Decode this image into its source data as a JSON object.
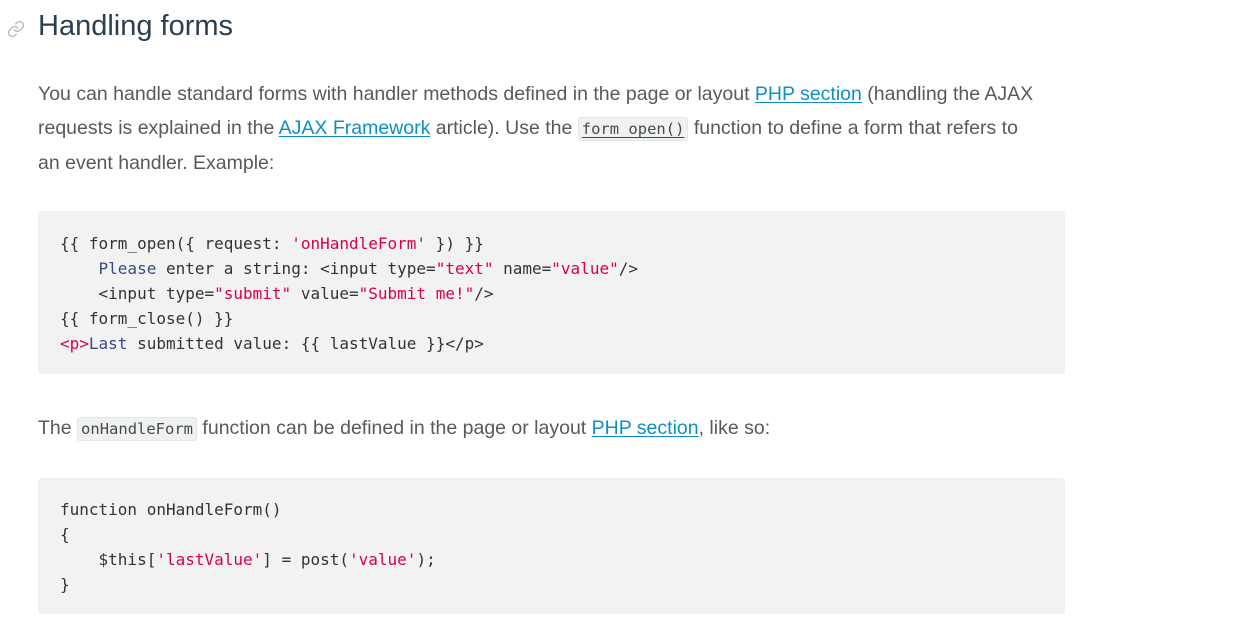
{
  "section": {
    "anchor_icon": "link-icon",
    "title": "Handling forms"
  },
  "intro": {
    "line1_text": "You can handle standard forms with handler methods defined in the page or layout ",
    "line1_link": "PHP section",
    "line1_after": " (handling the AJAX",
    "line2_before": "requests is explained in the ",
    "line2_link": "AJAX Framework",
    "line2_middle": " article). Use the ",
    "line2_code": "form_open()",
    "line2_after": " function to define a form that refers to",
    "line3_text": "an event handler. Example:"
  },
  "code_block_1": {
    "lines": [
      [
        {
          "t": "plain",
          "v": "{{ form_open({ request: "
        },
        {
          "t": "str",
          "v": "'onHandleForm'"
        },
        {
          "t": "plain",
          "v": " }) }}"
        }
      ],
      [
        {
          "t": "plain",
          "v": "    "
        },
        {
          "t": "kw",
          "v": "Please"
        },
        {
          "t": "plain",
          "v": " enter a string: <input type="
        },
        {
          "t": "str",
          "v": "\"text\""
        },
        {
          "t": "plain",
          "v": " name="
        },
        {
          "t": "str",
          "v": "\"value\""
        },
        {
          "t": "plain",
          "v": "/>"
        }
      ],
      [
        {
          "t": "plain",
          "v": "    <input type="
        },
        {
          "t": "str",
          "v": "\"submit\""
        },
        {
          "t": "plain",
          "v": " value="
        },
        {
          "t": "str",
          "v": "\"Submit me!\""
        },
        {
          "t": "plain",
          "v": "/>"
        }
      ],
      [
        {
          "t": "plain",
          "v": "{{ form_close() }}"
        }
      ],
      [
        {
          "t": "tag",
          "v": "<p>"
        },
        {
          "t": "kw",
          "v": "Last"
        },
        {
          "t": "plain",
          "v": " submitted value: {{ lastValue }}</p>"
        }
      ]
    ]
  },
  "middle": {
    "before": "The ",
    "code": "onHandleForm",
    "middle": " function can be defined in the page or layout ",
    "link": "PHP section",
    "after": ", like so:"
  },
  "code_block_2": {
    "lines": [
      [
        {
          "t": "plain",
          "v": "function onHandleForm()"
        }
      ],
      [
        {
          "t": "plain",
          "v": "{"
        }
      ],
      [
        {
          "t": "plain",
          "v": "    $this["
        },
        {
          "t": "str",
          "v": "'lastValue'"
        },
        {
          "t": "plain",
          "v": "] = post("
        },
        {
          "t": "str",
          "v": "'value'"
        },
        {
          "t": "plain",
          "v": ");"
        }
      ],
      [
        {
          "t": "plain",
          "v": "}"
        }
      ]
    ]
  },
  "colors": {
    "link": "#0e8fc2",
    "heading": "#2b3e50",
    "body_text": "#555a5f",
    "code_bg": "#f2f2f2",
    "code_string": "#d8004f",
    "code_keyword": "#3a4a7c"
  }
}
